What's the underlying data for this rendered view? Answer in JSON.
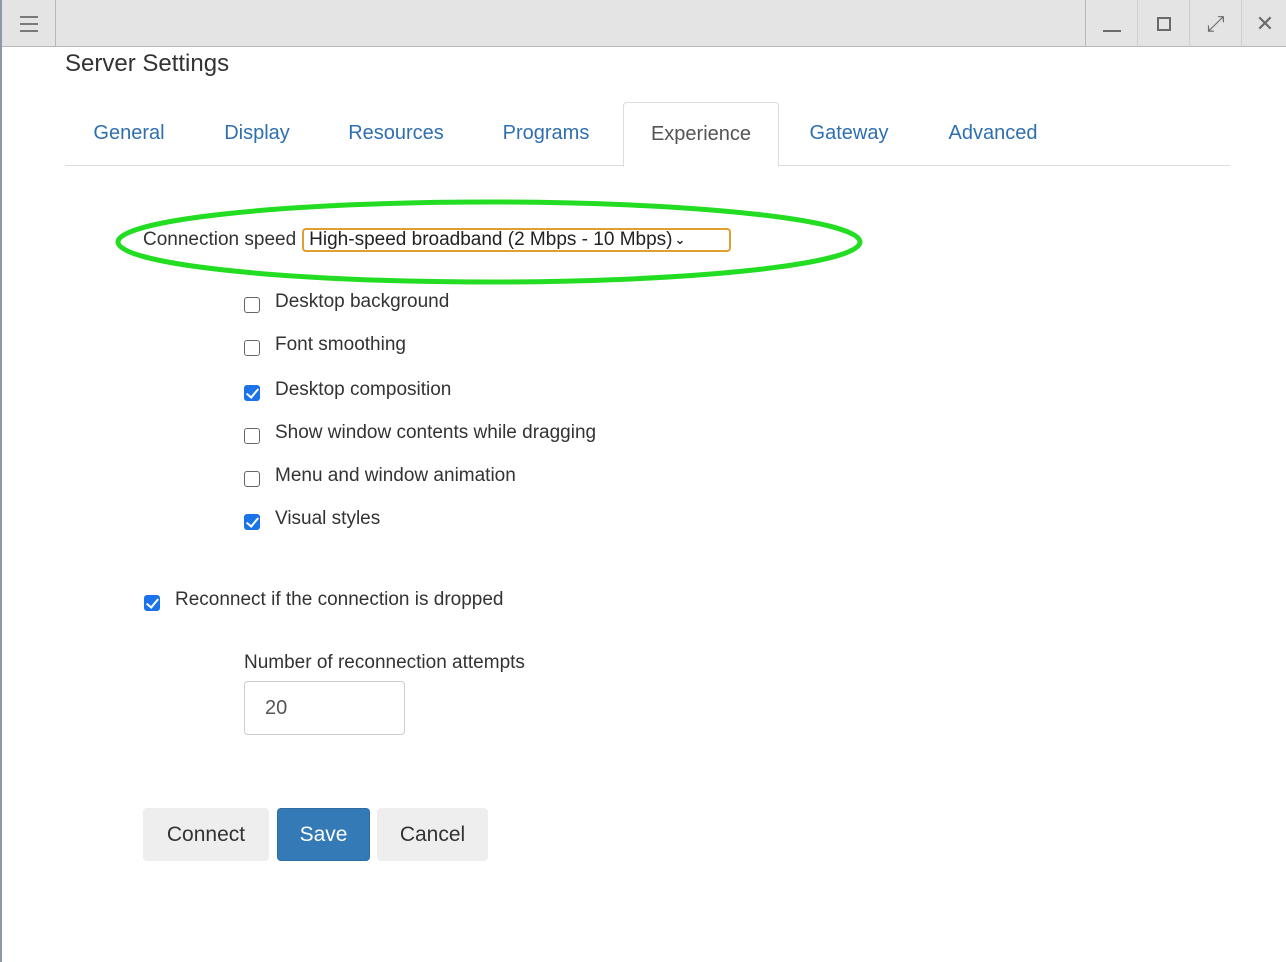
{
  "window": {
    "title": "Server Settings",
    "controls": {
      "menu_icon": "hamburger-menu-icon",
      "minimize_icon": "minimize-icon",
      "maximize_icon": "maximize-icon",
      "fullscreen_icon": "fullscreen-icon",
      "close_icon": "close-icon",
      "close_glyph": "✕",
      "fullscreen_glyph": "⤢"
    }
  },
  "tabs": [
    {
      "label": "General",
      "active": false
    },
    {
      "label": "Display",
      "active": false
    },
    {
      "label": "Resources",
      "active": false
    },
    {
      "label": "Programs",
      "active": false
    },
    {
      "label": "Experience",
      "active": true
    },
    {
      "label": "Gateway",
      "active": false
    },
    {
      "label": "Advanced",
      "active": false
    }
  ],
  "connection_speed": {
    "label": "Connection speed",
    "selected": "High-speed broadband (2 Mbps - 10 Mbps)",
    "highlight_color": "#22dd22",
    "focus_color": "#e0a030"
  },
  "experience_options": [
    {
      "label": "Desktop background",
      "checked": false
    },
    {
      "label": "Font smoothing",
      "checked": false
    },
    {
      "label": "Desktop composition",
      "checked": true
    },
    {
      "label": "Show window contents while dragging",
      "checked": false
    },
    {
      "label": "Menu and window animation",
      "checked": false
    },
    {
      "label": "Visual styles",
      "checked": true
    }
  ],
  "reconnect": {
    "label": "Reconnect if the connection is dropped",
    "checked": true,
    "attempts_label": "Number of reconnection attempts",
    "attempts_value": "20"
  },
  "buttons": {
    "connect": "Connect",
    "save": "Save",
    "cancel": "Cancel"
  },
  "colors": {
    "accent": "#337ab7",
    "link": "#2f6fb0",
    "checkbox": "#1a73e8"
  }
}
